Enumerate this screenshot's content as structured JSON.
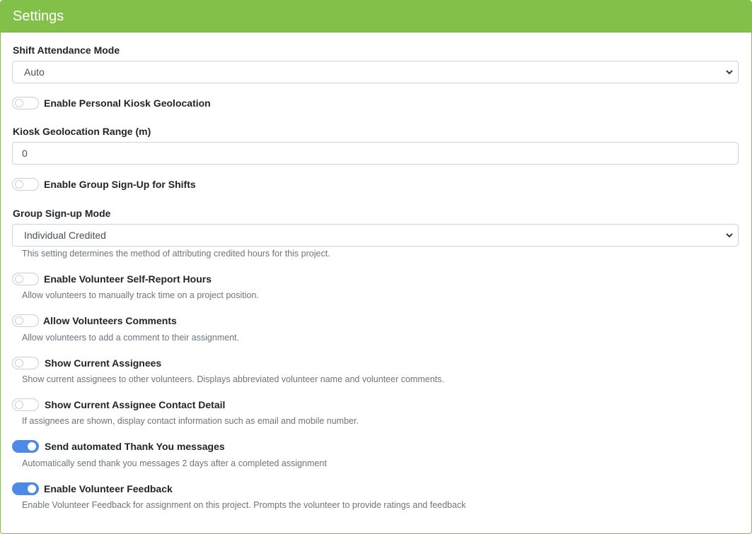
{
  "header": {
    "title": "Settings"
  },
  "shift_attendance": {
    "label": "Shift Attendance Mode",
    "value": "Auto"
  },
  "personal_kiosk_geolocation": {
    "label": "Enable Personal Kiosk Geolocation",
    "enabled": false
  },
  "kiosk_range": {
    "label": "Kiosk Geolocation Range (m)",
    "value": "0"
  },
  "group_signup": {
    "label": "Enable Group Sign-Up for Shifts",
    "enabled": false
  },
  "group_signup_mode": {
    "label": "Group Sign-up Mode",
    "value": "Individual Credited",
    "help": "This setting determines the method of attributing credited hours for this project."
  },
  "self_report_hours": {
    "label": "Enable Volunteer Self-Report Hours",
    "enabled": false,
    "help": "Allow volunteers to manually track time on a project position."
  },
  "volunteer_comments": {
    "label": "Allow Volunteers Comments",
    "enabled": false,
    "help": "Allow volunteers to add a comment to their assignment."
  },
  "show_assignees": {
    "label": "Show Current Assignees",
    "enabled": false,
    "help": "Show current assignees to other volunteers. Displays abbreviated volunteer name and volunteer comments."
  },
  "assignee_contact": {
    "label": "Show Current Assignee Contact Detail",
    "enabled": false,
    "help": "If assignees are shown, display contact information such as email and mobile number."
  },
  "thank_you": {
    "label": "Send automated Thank You messages",
    "enabled": true,
    "help": "Automatically send thank you messages 2 days after a completed assignment"
  },
  "feedback": {
    "label": "Enable Volunteer Feedback",
    "enabled": true,
    "help": "Enable Volunteer Feedback for assignment on this project. Prompts the volunteer to provide ratings and feedback"
  },
  "colors": {
    "header_green": "#82c04a",
    "toggle_on": "#4c89e8"
  }
}
